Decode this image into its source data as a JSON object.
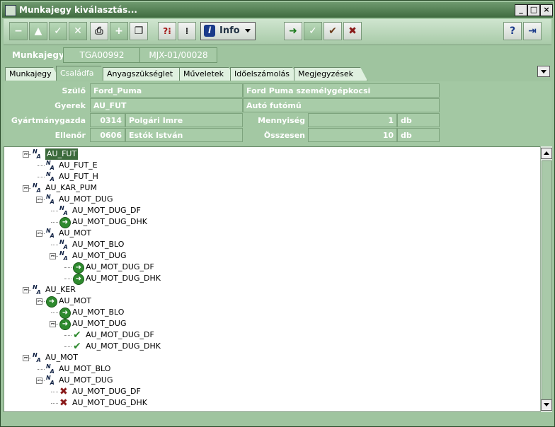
{
  "window": {
    "title": "Munkajegy kiválasztás..."
  },
  "header": {
    "label": "Munkajegy",
    "field1": "TGA00992",
    "field2": "MJX-01/00028"
  },
  "toolbar": {
    "info_label": "Info"
  },
  "tabs": [
    "Munkajegy",
    "Családfa",
    "Anyagszükséglet",
    "Műveletek",
    "Időelszámolás",
    "Megjegyzések"
  ],
  "active_tab": "Családfa",
  "panel": {
    "szulo_label": "Szülő",
    "szulo_code": "Ford_Puma",
    "szulo_name": "Ford Puma személygépkocsi",
    "gyerek_label": "Gyerek",
    "gyerek_code": "AU_FUT",
    "gyerek_name": "Autó futómű",
    "gyartmanygazda_label": "Gyártmánygazda",
    "gyartmanygazda_code": "0314",
    "gyartmanygazda_name": "Polgári Imre",
    "ellenor_label": "Ellenőr",
    "ellenor_code": "0606",
    "ellenor_name": "Estók István",
    "mennyiseg_label": "Mennyiség",
    "mennyiseg_value": "1",
    "mennyiseg_unit": "db",
    "osszesen_label": "Összesen",
    "osszesen_value": "10",
    "osszesen_unit": "db"
  },
  "tree": [
    {
      "label": "AU_FUT",
      "level": 0,
      "icon": "na-icon",
      "expander": "-",
      "selected": true
    },
    {
      "label": "AU_FUT_E",
      "level": 1,
      "icon": "na-icon"
    },
    {
      "label": "AU_FUT_H",
      "level": 1,
      "icon": "na-icon"
    },
    {
      "label": "AU_KAR_PUM",
      "level": 0,
      "icon": "na-icon",
      "expander": "-"
    },
    {
      "label": "AU_MOT_DUG",
      "level": 1,
      "icon": "na-icon",
      "expander": "-"
    },
    {
      "label": "AU_MOT_DUG_DF",
      "level": 2,
      "icon": "na-icon"
    },
    {
      "label": "AU_MOT_DUG_DHK",
      "level": 2,
      "icon": "go-icon"
    },
    {
      "label": "AU_MOT",
      "level": 1,
      "icon": "na-icon",
      "expander": "-"
    },
    {
      "label": "AU_MOT_BLO",
      "level": 2,
      "icon": "na-icon"
    },
    {
      "label": "AU_MOT_DUG",
      "level": 2,
      "icon": "na-icon",
      "expander": "-"
    },
    {
      "label": "AU_MOT_DUG_DF",
      "level": 3,
      "icon": "go-icon"
    },
    {
      "label": "AU_MOT_DUG_DHK",
      "level": 3,
      "icon": "go-icon"
    },
    {
      "label": "AU_KER",
      "level": 0,
      "icon": "na-icon",
      "expander": "-"
    },
    {
      "label": "AU_MOT",
      "level": 1,
      "icon": "go-icon",
      "expander": "-"
    },
    {
      "label": "AU_MOT_BLO",
      "level": 2,
      "icon": "go-icon"
    },
    {
      "label": "AU_MOT_DUG",
      "level": 2,
      "icon": "go-icon",
      "expander": "-"
    },
    {
      "label": "AU_MOT_DUG_DF",
      "level": 3,
      "icon": "check-icon"
    },
    {
      "label": "AU_MOT_DUG_DHK",
      "level": 3,
      "icon": "check-icon"
    },
    {
      "label": "AU_MOT",
      "level": 0,
      "icon": "na-icon",
      "expander": "-"
    },
    {
      "label": "AU_MOT_BLO",
      "level": 1,
      "icon": "na-icon"
    },
    {
      "label": "AU_MOT_DUG",
      "level": 1,
      "icon": "na-icon",
      "expander": "-"
    },
    {
      "label": "AU_MOT_DUG_DF",
      "level": 2,
      "icon": "cross-icon"
    },
    {
      "label": "AU_MOT_DUG_DHK",
      "level": 2,
      "icon": "cross-icon"
    }
  ]
}
